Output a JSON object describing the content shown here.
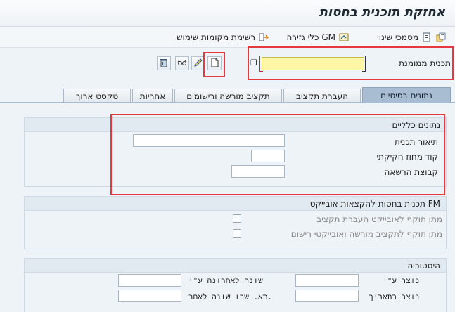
{
  "window": {
    "title": "אחזקת תוכנית בחסות"
  },
  "app_toolbar": {
    "create_icon": "create-object-icon",
    "docs_label": "מסמכי שינוי",
    "tools_label": "כלי גזירה GM",
    "where_used_label": "רשימת מקומות שימוש"
  },
  "plan_field": {
    "label": "תכנית ממומנת",
    "value": ""
  },
  "tabs": [
    {
      "label": "נתונים בסיסיים",
      "active": true
    },
    {
      "label": "העברת תקציב",
      "active": false
    },
    {
      "label": "תקציב מורשה ורישומים",
      "active": false
    },
    {
      "label": "אחריות",
      "active": false
    },
    {
      "label": "טקסט ארוך",
      "active": false
    }
  ],
  "general_data": {
    "title": "נתונים כלליים",
    "plan_description_label": "תיאור תכנית",
    "legal_district_label": "קוד מחוז חקיקתי",
    "authorization_group_label": "קבוצת הרשאה"
  },
  "fm_allocation": {
    "title": "תכנית בחסות להקצאות אובייקט FM",
    "budget_transfer_label": "מתן תוקף לאובייקט העברת תקציב",
    "authorized_posting_label": "מתן תוקף לתקציב מורשה ואובייקטי רישום"
  },
  "history": {
    "title": "היסטוריה",
    "created_by_label": "נוצר ע\"י",
    "last_changed_by_label": "שונה לאחרונה ע\"י",
    "created_on_label": "נוצר בתאריך",
    "last_changed_on_label": "תא. שבו שונה לאחר."
  },
  "colors": {
    "accent_tab": "#a9bdd2",
    "highlight": "#e3393f",
    "required_field": "#fff7a6"
  }
}
